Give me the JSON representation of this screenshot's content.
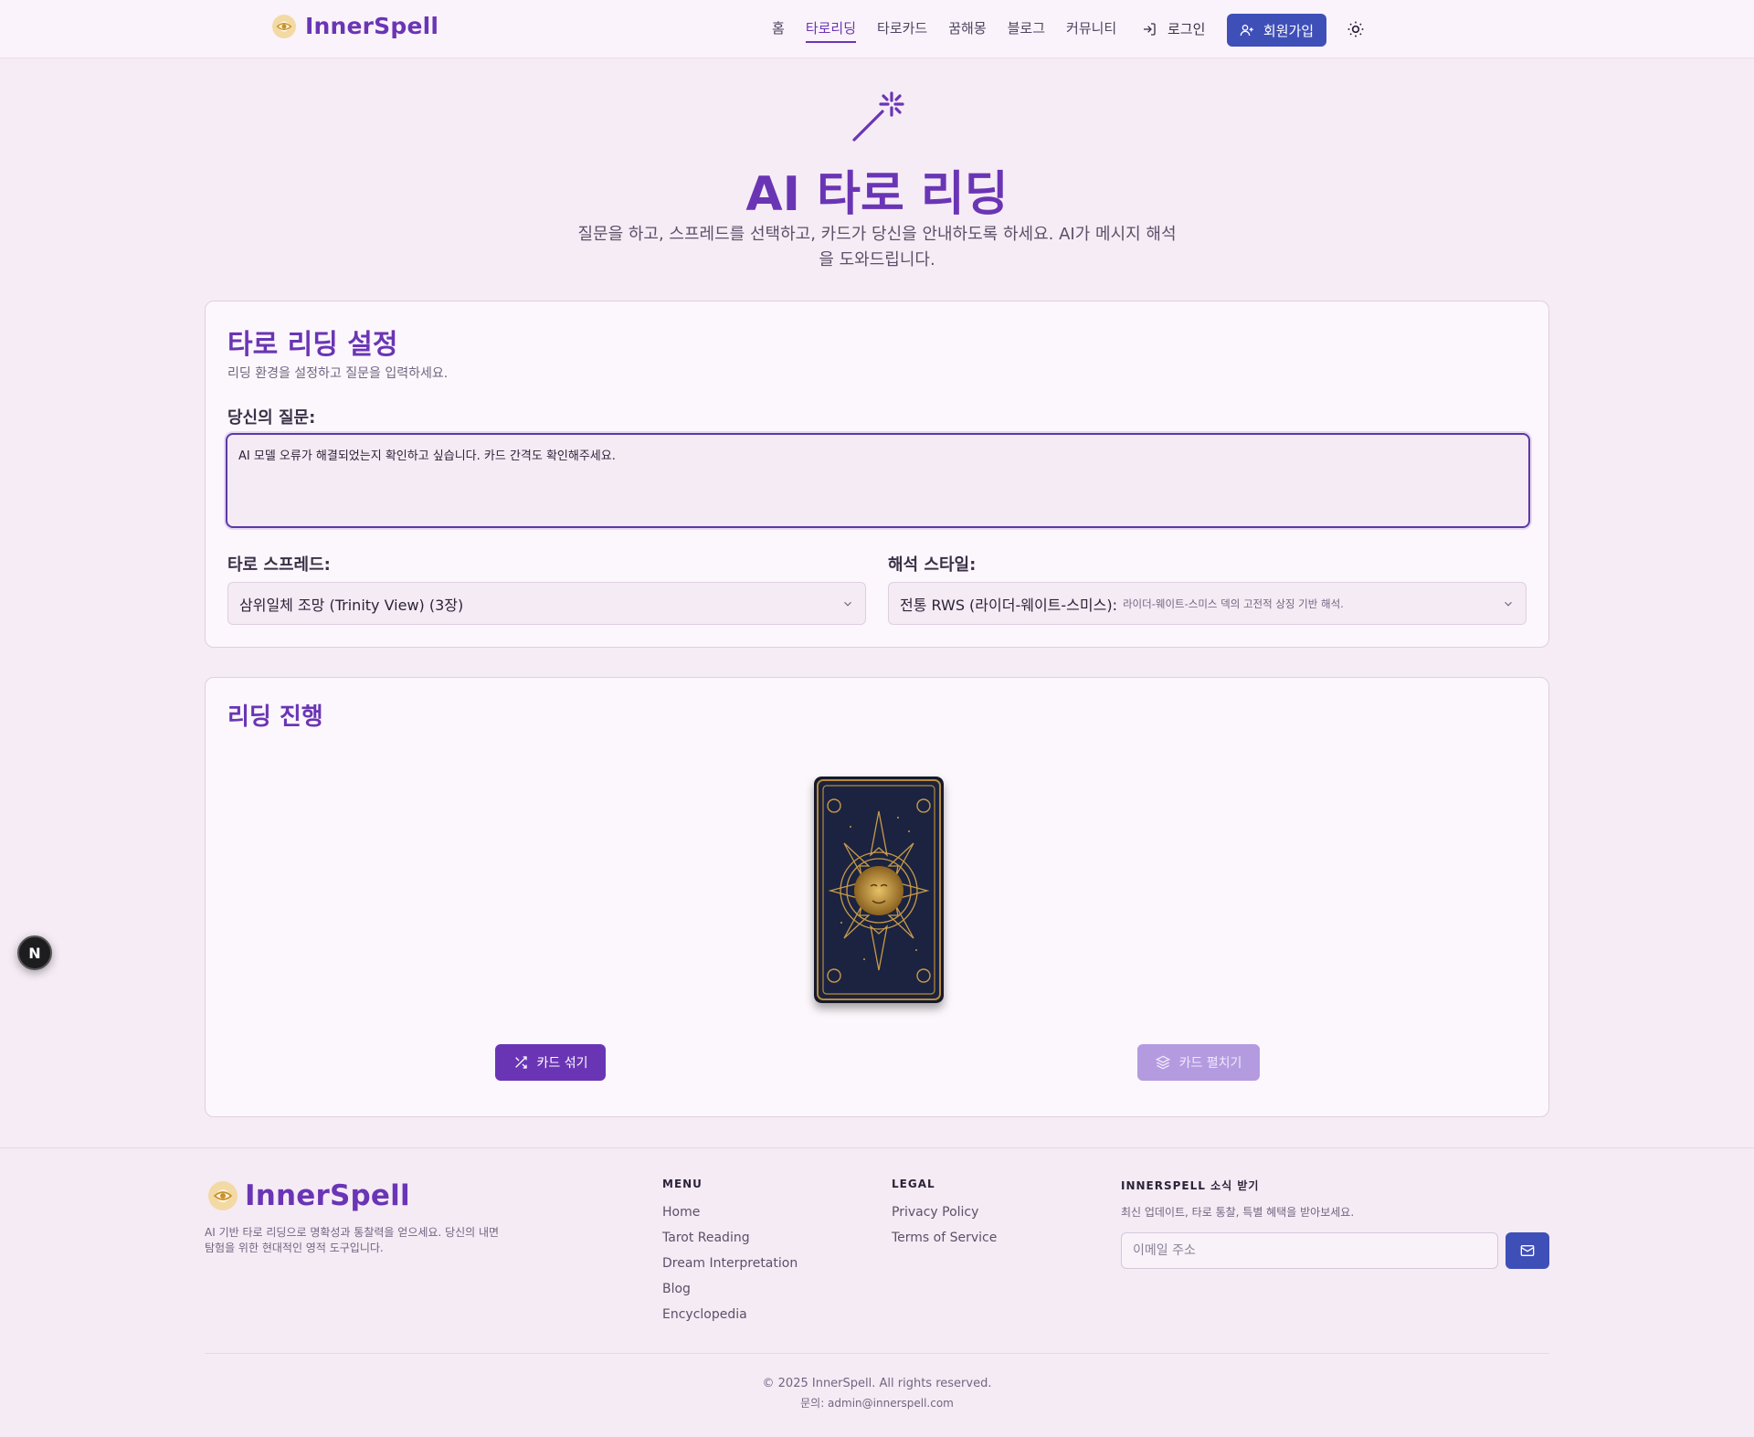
{
  "header": {
    "brand": "InnerSpell",
    "nav": [
      "홈",
      "타로리딩",
      "타로카드",
      "꿈해몽",
      "블로그",
      "커뮤니티"
    ],
    "active_nav": "타로리딩",
    "login": "로그인",
    "signup": "회원가입"
  },
  "hero": {
    "title": "AI 타로 리딩",
    "subtitle_line1": "질문을 하고, 스프레드를 선택하고, 카드가 당신을 안내하도록 하세요. AI가 메시지 해석",
    "subtitle_line2": "을 도와드립니다."
  },
  "settings": {
    "title": "타로 리딩 설정",
    "description": "리딩 환경을 설정하고 질문을 입력하세요.",
    "question_label": "당신의 질문:",
    "question_value": "AI 모델 오류가 해결되었는지 확인하고 싶습니다. 카드 간격도 확인해주세요.",
    "spread_label": "타로 스프레드:",
    "spread_value": "삼위일체 조망 (Trinity View) (3장)",
    "style_label": "해석 스타일:",
    "style_value": "전통 RWS (라이더-웨이트-스미스):",
    "style_note": "라이더-웨이트-스미스 덱의 고전적 상징 기반 해석."
  },
  "reading": {
    "title": "리딩 진행",
    "shuffle": "카드 섞기",
    "spread": "카드 펼치기"
  },
  "floating_badge": "N",
  "footer": {
    "brand": "InnerSpell",
    "description": "AI 기반 타로 리딩으로 명확성과 통찰력을 얻으세요. 당신의 내면 탐험을 위한 현대적인 영적 도구입니다.",
    "menu_title": "MENU",
    "menu": [
      "Home",
      "Tarot Reading",
      "Dream Interpretation",
      "Blog",
      "Encyclopedia"
    ],
    "legal_title": "LEGAL",
    "legal": [
      "Privacy Policy",
      "Terms of Service"
    ],
    "newsletter_title": "INNERSPELL 소식 받기",
    "newsletter_desc": "최신 업데이트, 타로 통찰, 특별 혜택을 받아보세요.",
    "email_placeholder": "이메일 주소",
    "copyright": "© 2025 InnerSpell. All rights reserved.",
    "contact": "문의: admin@innerspell.com"
  },
  "colors": {
    "accent": "#6a35b5",
    "primary_button": "#3f4fb8",
    "background": "#f6ecf6"
  }
}
